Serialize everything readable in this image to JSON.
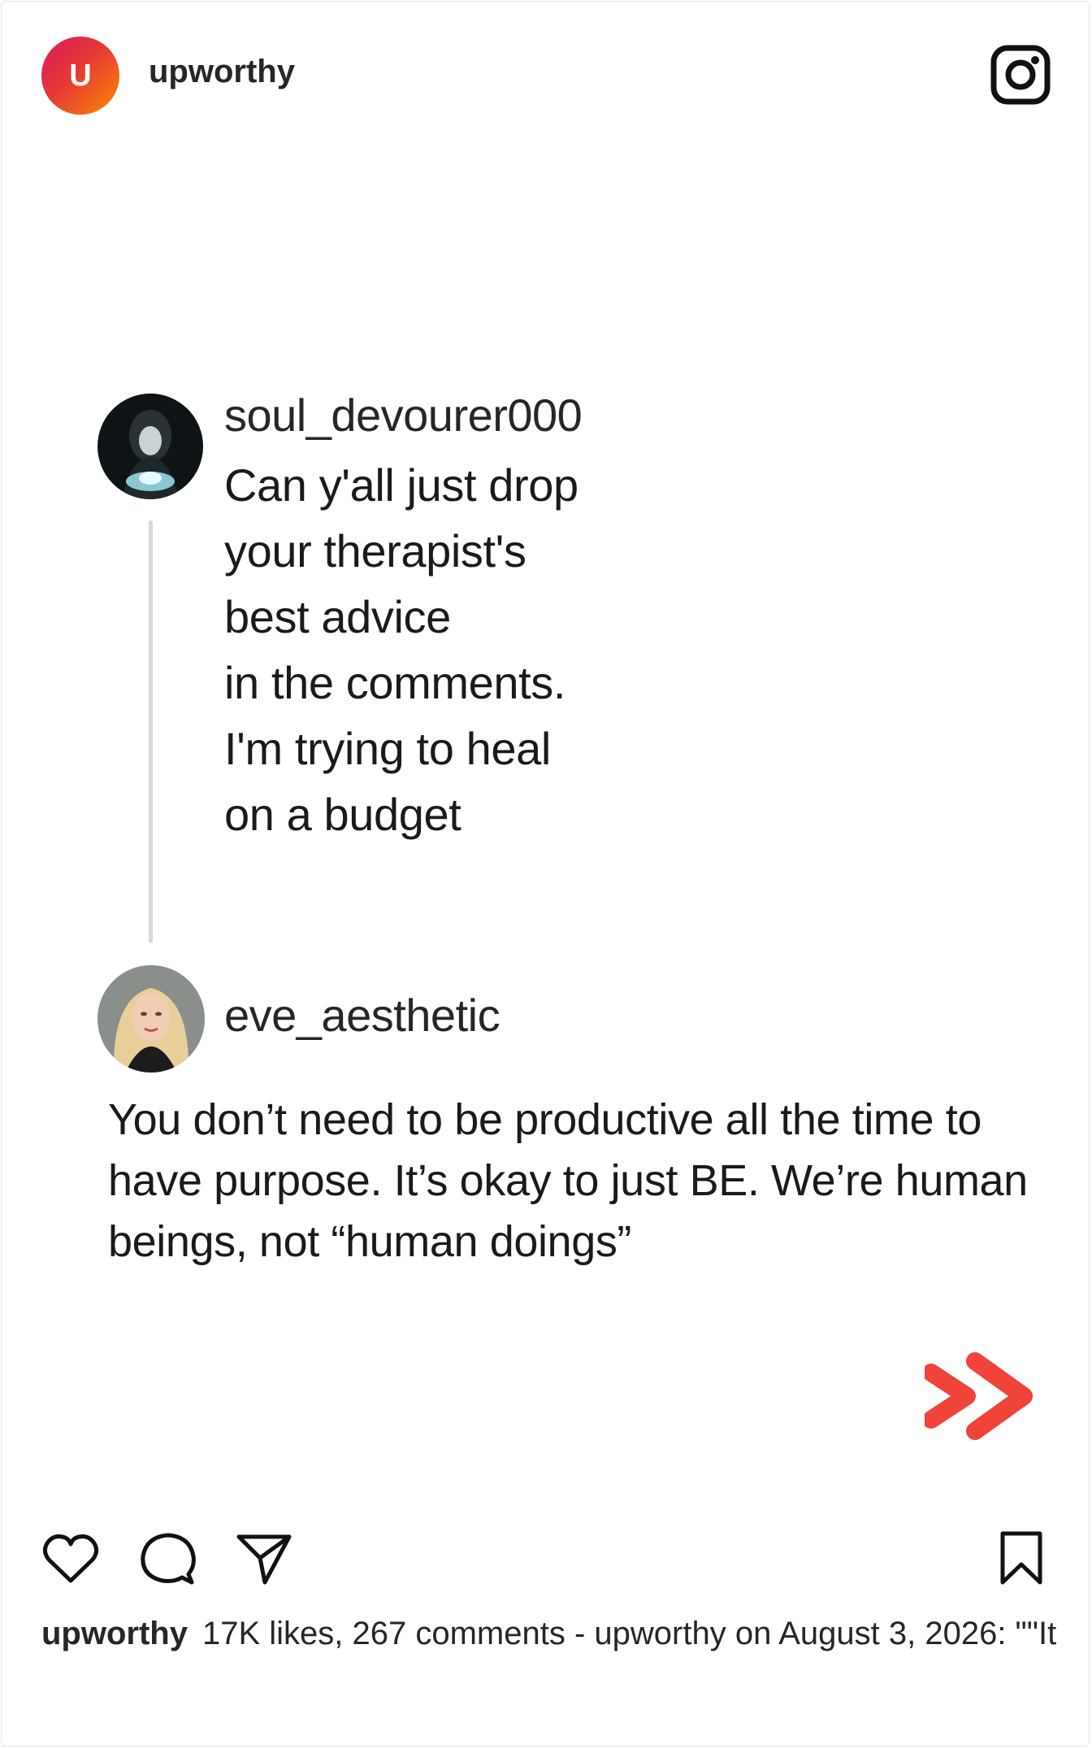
{
  "header": {
    "avatar_letter": "U",
    "account_name": "upworthy",
    "platform_icon": "instagram-icon"
  },
  "post": {
    "original_comment": {
      "username": "soul_devourer000",
      "lines": [
        "Can y'all just drop",
        "your therapist's",
        "best advice",
        "in the comments.",
        "I'm trying to heal",
        "on a budget"
      ]
    },
    "reply_comment": {
      "username": "eve_aesthetic",
      "text": "You don’t need to be productive all the time to have purpose. It’s okay to just BE. We’re human beings, not “human doings”"
    },
    "next_icon": "double-chevron-right-icon",
    "accent_color": "#f0433a"
  },
  "actions": {
    "like_icon": "heart-icon",
    "comment_icon": "comment-icon",
    "share_icon": "send-icon",
    "save_icon": "bookmark-icon"
  },
  "caption": {
    "handle": "upworthy",
    "text": "17K likes, 267 comments - upworthy on August 3, 2026: \"\"It"
  }
}
